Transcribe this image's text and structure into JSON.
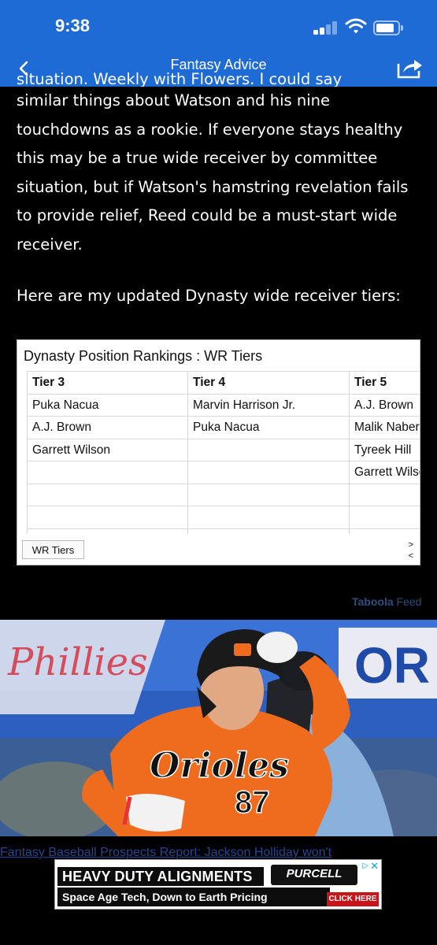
{
  "status_bar": {
    "time": "9:38"
  },
  "nav": {
    "title": "Fantasy Advice"
  },
  "article": {
    "partial_line": "situation. Weekly with Flowers. I could say",
    "paragraph1": "similar things about Watson and his nine touchdowns as a rookie. If everyone stays healthy this may be a true wide receiver by committee situation, but if Watson's hamstring revelation fails to provide relief, Reed could be a must-start wide receiver.",
    "paragraph2": "Here are my updated Dynasty wide receiver tiers:"
  },
  "table_widget": {
    "title": "Dynasty Position Rankings : WR Tiers",
    "headers": [
      "Tier 3",
      "Tier 4",
      "Tier 5"
    ],
    "rows": [
      [
        "Puka Nacua",
        "Marvin Harrison Jr.",
        "A.J. Brown"
      ],
      [
        "A.J. Brown",
        "Puka Nacua",
        "Malik Nabers"
      ],
      [
        "Garrett Wilson",
        "",
        "Tyreek Hill"
      ],
      [
        "",
        "",
        "Garrett Wilson"
      ],
      [
        "",
        "",
        ""
      ],
      [
        "",
        "",
        ""
      ],
      [
        "",
        "",
        ""
      ]
    ],
    "sheet_tab": "WR Tiers",
    "next_arrow": ">",
    "prev_arrow": "<"
  },
  "taboola": {
    "brand": "Taboola",
    "suffix": "Feed"
  },
  "feed_item": {
    "headline": "Fantasy Baseball Prospects Report: Jackson Holliday won't",
    "jersey_text": "Orioles",
    "jersey_number": "87"
  },
  "ad": {
    "line1": "HEAVY DUTY ALIGNMENTS",
    "line2": "Space Age Tech, Down to Earth Pricing",
    "brand": "PURCELL",
    "cta": "CLICK HERE"
  },
  "colors": {
    "nav_blue": "#1f6bd6",
    "background": "#000000",
    "taboola_blue": "#2c4f80"
  },
  "icons": [
    "back-chevron-icon",
    "share-icon",
    "signal-icon",
    "wifi-icon",
    "battery-icon",
    "ad-info-icon",
    "ad-close-icon"
  ]
}
